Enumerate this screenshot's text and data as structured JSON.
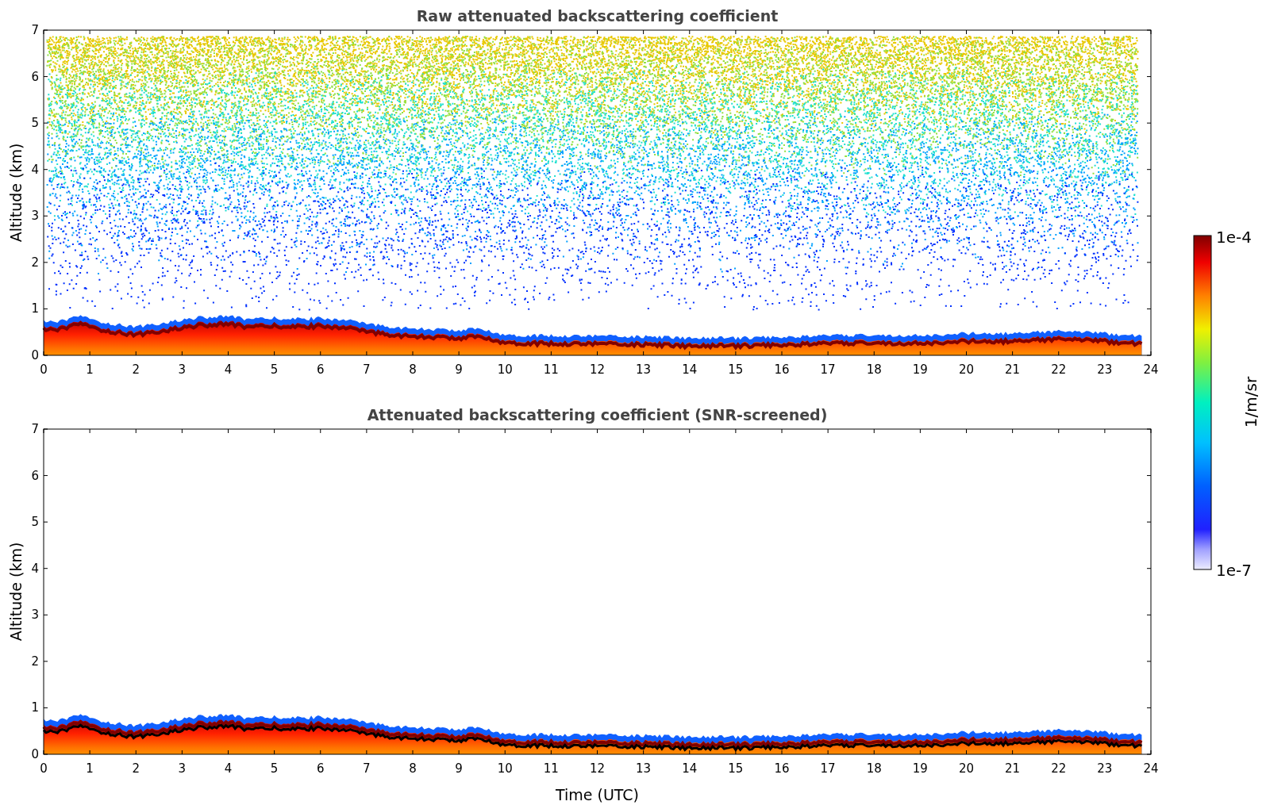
{
  "panels": [
    {
      "kind": "raw",
      "title": "Raw attenuated backscattering coefficient",
      "ylabel": "Altitude (km)",
      "yticks": [
        "7",
        "6",
        "5",
        "4",
        "3",
        "2",
        "1",
        "0"
      ],
      "xticks": [
        "0",
        "1",
        "2",
        "3",
        "4",
        "5",
        "6",
        "7",
        "8",
        "9",
        "10",
        "11",
        "12",
        "13",
        "14",
        "15",
        "16",
        "17",
        "18",
        "19",
        "20",
        "21",
        "22",
        "23",
        "24"
      ]
    },
    {
      "kind": "screened",
      "title": "Attenuated backscattering coefficient (SNR-screened)",
      "ylabel": "Altitude (km)",
      "yticks": [
        "7",
        "6",
        "5",
        "4",
        "3",
        "2",
        "1",
        "0"
      ],
      "xticks": [
        "0",
        "1",
        "2",
        "3",
        "4",
        "5",
        "6",
        "7",
        "8",
        "9",
        "10",
        "11",
        "12",
        "13",
        "14",
        "15",
        "16",
        "17",
        "18",
        "19",
        "20",
        "21",
        "22",
        "23",
        "24"
      ],
      "xlabel": "Time (UTC)"
    }
  ],
  "colorbar": {
    "max_label": "1e-4",
    "min_label": "1e-7",
    "unit": "1/m/sr"
  }
}
